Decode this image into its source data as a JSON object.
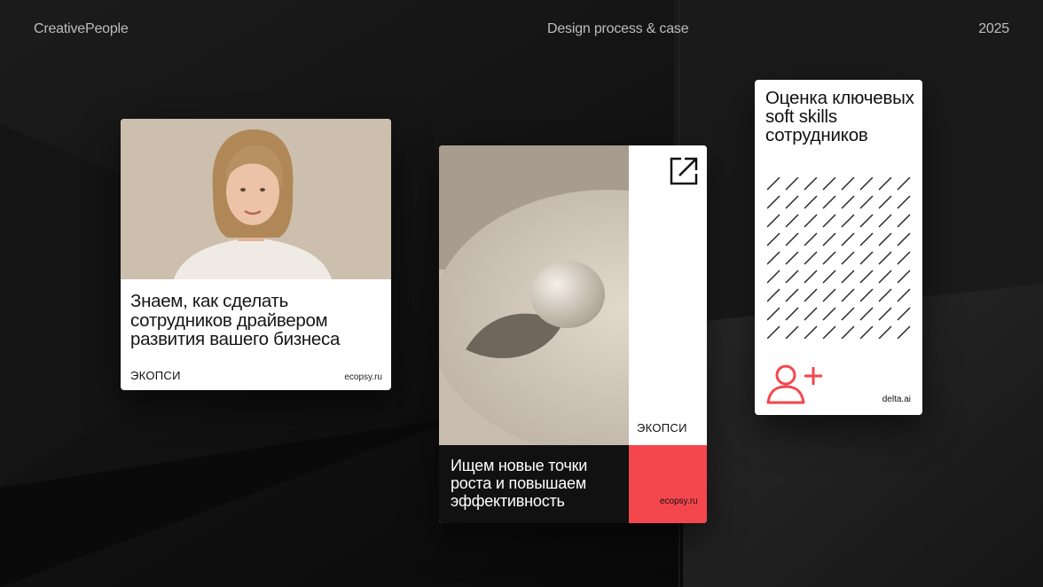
{
  "header": {
    "brand": "CreativePeople",
    "subtitle": "Design process & case",
    "year": "2025"
  },
  "card1": {
    "headline": "Знаем, как сделать сотрудников драйвером развития вашего бизнеса",
    "logo": "ЭКОПСИ",
    "domain": "ecopsy.ru"
  },
  "card2": {
    "headline": "Ищем новые точки роста и повышаем эффективность",
    "logo": "ЭКОПСИ",
    "domain": "ecopsy.ru",
    "icon": "external-link-icon"
  },
  "card3": {
    "headline": "Оценка ключевых soft skills сотрудников",
    "domain": "delta.ai",
    "icon": "add-user-icon"
  },
  "colors": {
    "accent": "#f4474d",
    "background": "#0b0b0b",
    "photo_beige": "#cdbfae"
  }
}
